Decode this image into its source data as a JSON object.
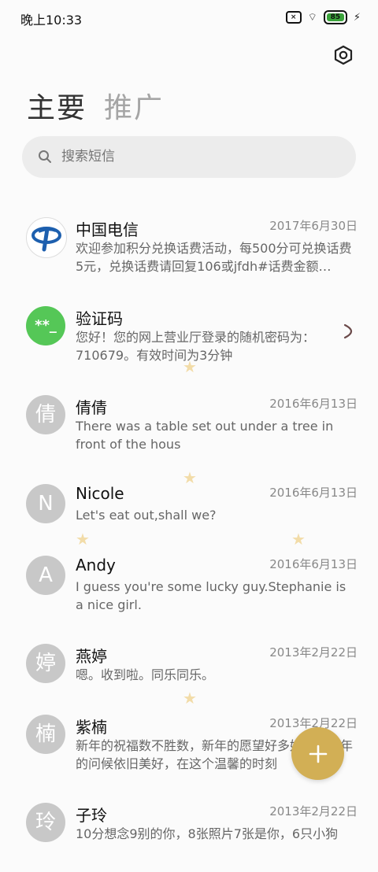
{
  "status_bar": {
    "time": "晚上10:33",
    "battery": "85"
  },
  "tabs": [
    {
      "label": "主要"
    },
    {
      "label": "推广"
    }
  ],
  "search": {
    "placeholder": "搜索短信"
  },
  "messages": [
    {
      "avatar": "",
      "name": "中国电信",
      "date": "2017年6月30日",
      "preview": "欢迎参加积分兑换话费活动，每500分可兑换话费5元，兑换话费请回复106或jfdh#话费金额…"
    },
    {
      "avatar": "**_",
      "name": "验证码",
      "date": "",
      "preview": "您好！您的网上营业厅登录的随机密码为：710679。有效时间为3分钟"
    },
    {
      "avatar": "倩",
      "name": "倩倩",
      "date": "2016年6月13日",
      "preview": "There was a table set out under a tree in front of the hous"
    },
    {
      "avatar": "N",
      "name": "Nicole",
      "date": "2016年6月13日",
      "preview": "Let's eat out,shall we?"
    },
    {
      "avatar": "A",
      "name": "Andy",
      "date": "2016年6月13日",
      "preview": "I guess you're some lucky guy.Stephanie is a nice girl."
    },
    {
      "avatar": "婷",
      "name": "燕婷",
      "date": "2013年2月22日",
      "preview": "嗯。收到啦。同乐同乐。"
    },
    {
      "avatar": "楠",
      "name": "紫楠",
      "date": "2013年2月22日",
      "preview": "新年的祝福数不胜数，新年的愿望好多好多，新年的问候依旧美好，在这个温馨的时刻"
    },
    {
      "avatar": "玲",
      "name": "子玲",
      "date": "2013年2月22日",
      "preview": "10分想念9别的你，8张照片7张是你，6只小狗"
    }
  ],
  "fab": {
    "label": "+"
  },
  "colors": {
    "accent": "#d2af55",
    "verify_avatar": "#55c757",
    "avatar_gray": "#c8c8c8"
  }
}
